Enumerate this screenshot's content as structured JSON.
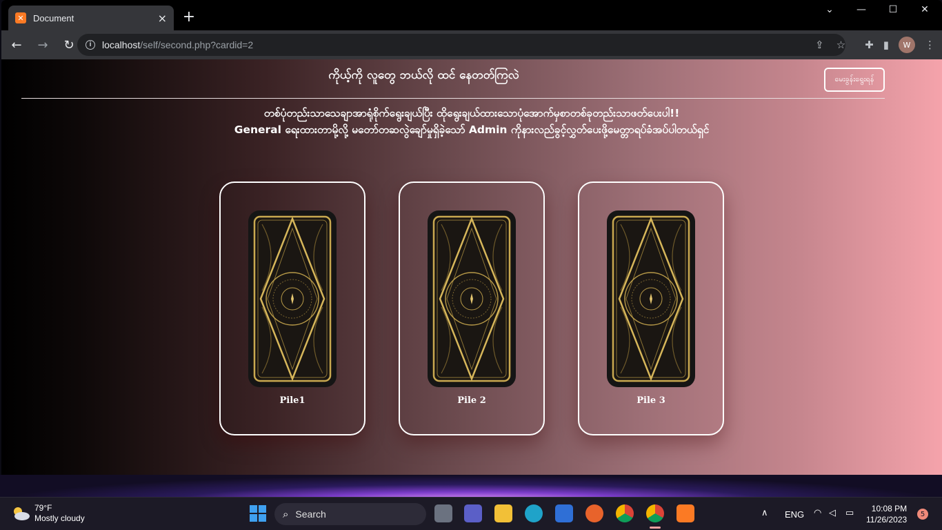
{
  "browser": {
    "tab_title": "Document",
    "url_host": "localhost",
    "url_path": "/self/second.php?cardid=2",
    "profile_initial": "W"
  },
  "page": {
    "nav_title": "ကိုယ့်ကို လူတွေ ဘယ်လို ထင် နေတတ်ကြလဲ",
    "nav_button": "မေးခွန်းရွေးရန်",
    "instruction_line1": "တစ်ပုံတည်းသာသေချာအာရုံစိုက်ရွေးချယ်ပြီး ထိုရွေးချယ်ထားသောပုံအောက်မှစာတစ်ခုတည်းသာဖတ်ပေးပါ!!",
    "instruction_line2": "General ရေးထားတာမို့လို့ မတော်တဆလွဲချော်မှုရှိခဲ့သော် Admin ကိုနားလည်ခွင့်လွှတ်ပေးဖို့မေတ္တာရပ်ခံအပ်ပါတယ်ရှင်",
    "piles": [
      {
        "label": "Pile1"
      },
      {
        "label": "Pile 2"
      },
      {
        "label": "Pile 3"
      }
    ]
  },
  "taskbar": {
    "temperature": "79°F",
    "weather": "Mostly cloudy",
    "search_label": "Search",
    "language": "ENG",
    "time": "10:08 PM",
    "date": "11/26/2023",
    "notification_count": "5"
  }
}
